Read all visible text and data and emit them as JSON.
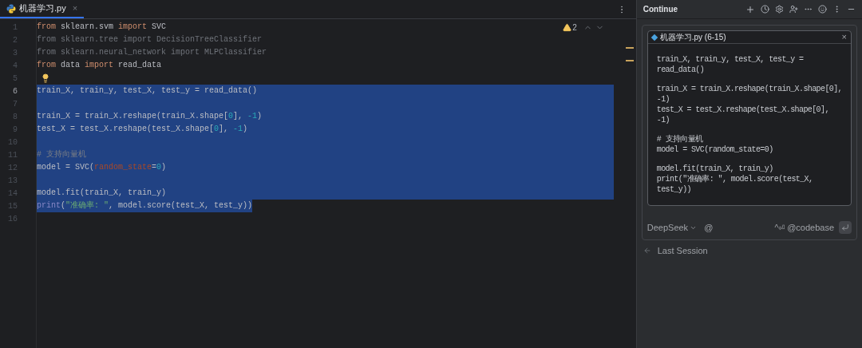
{
  "tab": {
    "label": "机器学习.py",
    "close": "×"
  },
  "inspections": {
    "warnings": "2"
  },
  "editor": {
    "lines": [
      {
        "number": "1",
        "selected": false,
        "current": false,
        "lightbulb": false,
        "tokens": [
          {
            "kind": "keyword",
            "text": "from"
          },
          {
            "kind": "plain",
            "text": " sklearn.svm "
          },
          {
            "kind": "keyword",
            "text": "import"
          },
          {
            "kind": "plain",
            "text": " SVC"
          }
        ]
      },
      {
        "number": "2",
        "selected": false,
        "current": false,
        "lightbulb": false,
        "tokens": [
          {
            "kind": "unused",
            "text": "from sklearn.tree import DecisionTreeClassifier"
          }
        ]
      },
      {
        "number": "3",
        "selected": false,
        "current": false,
        "lightbulb": false,
        "tokens": [
          {
            "kind": "unused",
            "text": "from sklearn.neural_network import MLPClassifier"
          }
        ]
      },
      {
        "number": "4",
        "selected": false,
        "current": false,
        "lightbulb": false,
        "tokens": [
          {
            "kind": "keyword",
            "text": "from"
          },
          {
            "kind": "plain",
            "text": " data "
          },
          {
            "kind": "keyword",
            "text": "import"
          },
          {
            "kind": "plain",
            "text": " read_data"
          }
        ]
      },
      {
        "number": "5",
        "selected": false,
        "current": false,
        "lightbulb": true
      },
      {
        "number": "6",
        "selected": true,
        "current": true,
        "lightbulb": false,
        "tokens": [
          {
            "kind": "plain",
            "text": "train_X, train_y, test_X, test_y = read_data()"
          }
        ]
      },
      {
        "number": "7",
        "selected": true,
        "current": false,
        "lightbulb": false
      },
      {
        "number": "8",
        "selected": true,
        "current": false,
        "lightbulb": false,
        "tokens": [
          {
            "kind": "plain",
            "text": "train_X = train_X.reshape(train_X.shape["
          },
          {
            "kind": "number",
            "text": "0"
          },
          {
            "kind": "plain",
            "text": "], "
          },
          {
            "kind": "number",
            "text": "-1"
          },
          {
            "kind": "plain",
            "text": ")"
          }
        ]
      },
      {
        "number": "9",
        "selected": true,
        "current": false,
        "lightbulb": false,
        "tokens": [
          {
            "kind": "plain",
            "text": "test_X = test_X.reshape(test_X.shape["
          },
          {
            "kind": "number",
            "text": "0"
          },
          {
            "kind": "plain",
            "text": "], "
          },
          {
            "kind": "number",
            "text": "-1"
          },
          {
            "kind": "plain",
            "text": ")"
          }
        ]
      },
      {
        "number": "10",
        "selected": true,
        "current": false,
        "lightbulb": false
      },
      {
        "number": "11",
        "selected": true,
        "current": false,
        "lightbulb": false,
        "tokens": [
          {
            "kind": "comment",
            "text": "# 支持向量机"
          }
        ]
      },
      {
        "number": "12",
        "selected": true,
        "current": false,
        "lightbulb": false,
        "tokens": [
          {
            "kind": "plain",
            "text": "model = SVC("
          },
          {
            "kind": "param",
            "text": "random_state"
          },
          {
            "kind": "plain",
            "text": "="
          },
          {
            "kind": "number",
            "text": "0"
          },
          {
            "kind": "plain",
            "text": ")"
          }
        ]
      },
      {
        "number": "13",
        "selected": true,
        "current": false,
        "lightbulb": false
      },
      {
        "number": "14",
        "selected": true,
        "current": false,
        "lightbulb": false,
        "tokens": [
          {
            "kind": "plain",
            "text": "model.fit(train_X, train_y)"
          }
        ]
      },
      {
        "number": "15",
        "selected": true,
        "current": false,
        "lightbulb": false,
        "tokens": [
          {
            "kind": "builtin",
            "text": "print"
          },
          {
            "kind": "plain",
            "text": "("
          },
          {
            "kind": "string",
            "text": "\"准确率: \""
          },
          {
            "kind": "plain",
            "text": ", model.score(test_X, test_y))"
          }
        ]
      },
      {
        "number": "16",
        "selected": false,
        "current": false,
        "lightbulb": false
      }
    ]
  },
  "chat": {
    "title": "Continue",
    "context": {
      "file": "机器学习.py (6-15)",
      "close": "×",
      "blocks": [
        [
          "train_X, train_y, test_X, test_y =",
          "read_data()"
        ],
        [
          "train_X = train_X.reshape(train_X.shape[0],",
          "-1)",
          "test_X = test_X.reshape(test_X.shape[0],",
          "-1)"
        ],
        [
          "# 支持向量机",
          "model = SVC(random_state=0)"
        ],
        [
          "model.fit(train_X, train_y)",
          "print(\"准确率: \", model.score(test_X,",
          "test_y))"
        ]
      ]
    },
    "model": "DeepSeek",
    "at": "@",
    "shortcut": "^⏎",
    "codebase": "@codebase",
    "last_session": "Last Session"
  }
}
